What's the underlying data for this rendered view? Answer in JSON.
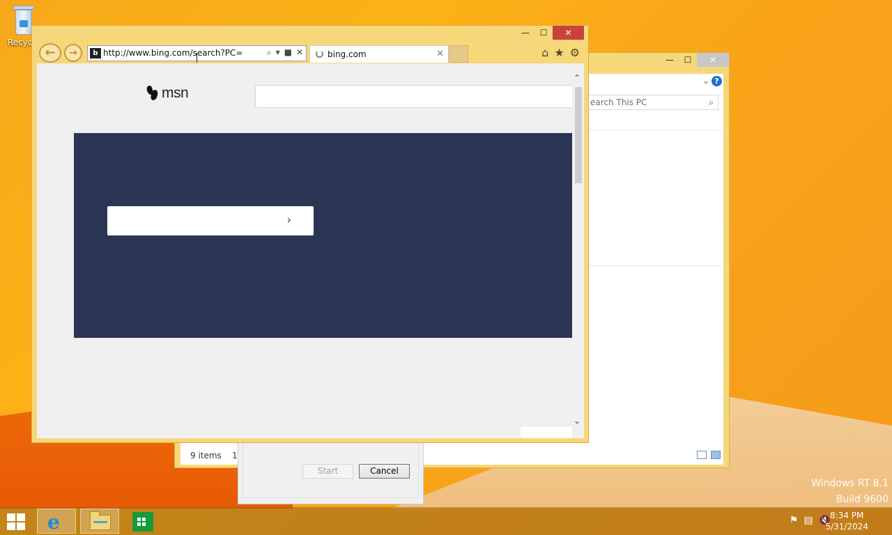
{
  "desktop": {
    "recycle_label": "Recycle",
    "watermark_line1": "Windows RT 8.1",
    "watermark_line2": "Build 9600"
  },
  "explorer": {
    "caption_min": "—",
    "caption_max": "☐",
    "caption_close": "✕",
    "chevron": "⌄",
    "help": "?",
    "search_placeholder": "earch This PC",
    "status_items": "9 items",
    "status_selected": "1"
  },
  "dialog": {
    "start_label": "Start",
    "cancel_label": "Cancel"
  },
  "ie": {
    "caption_min": "—",
    "caption_max": "☐",
    "caption_close": "✕",
    "back_icon": "←",
    "forward_icon": "→",
    "address_url": "http://www.bing.com/search?PC=WCUG",
    "address_search_icon": "⌕",
    "address_dropdown_icon": "▾",
    "address_lock_icon": "🔒",
    "address_stop_icon": "✕",
    "tab_title": "bing.com",
    "tab_close_icon": "✕",
    "home_icon": "⌂",
    "favorites_icon": "★",
    "tools_icon": "⚙",
    "msn_logo_text": "msn",
    "hero_button_arrow": "›",
    "scroll_up": "⌃",
    "scroll_down": "⌄"
  },
  "taskbar": {
    "ie_glyph": "e",
    "time": "8:34 PM",
    "date": "5/31/2024",
    "tray_icons": [
      "flag-icon",
      "network-icon",
      "volume-muted-icon"
    ]
  },
  "colors": {
    "desktop_orange": "#fcb216",
    "ie_frame": "#f6d77a",
    "close_red": "#c7443d",
    "hero_navy": "#2b3654",
    "help_blue": "#1f6fd1"
  }
}
